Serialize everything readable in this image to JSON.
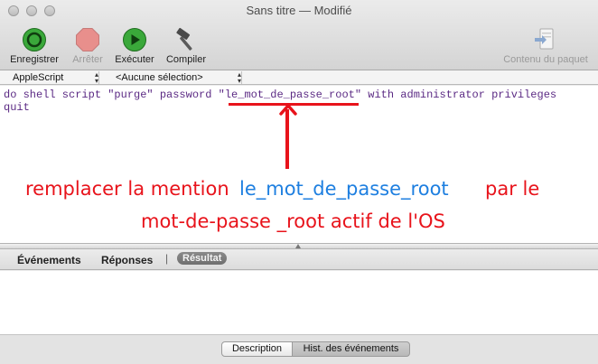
{
  "window": {
    "title": "Sans titre — Modifié"
  },
  "toolbar": {
    "record_label": "Enregistrer",
    "stop_label": "Arrêter",
    "run_label": "Exécuter",
    "compile_label": "Compiler",
    "bundle_label": "Contenu du paquet"
  },
  "selectors": {
    "language": "AppleScript",
    "navigation": "<Aucune sélection>"
  },
  "editor": {
    "line1_prefix": "do shell script \"purge\" password ",
    "line1_string": "\"le_mot_de_passe_root\"",
    "line1_suffix": " with administrator privileges",
    "line2": "quit"
  },
  "annotation": {
    "part1": "remplacer la mention",
    "part2": "le_mot_de_passe_root",
    "part3": "par le",
    "line2": "mot-de-passe _root actif de l'OS"
  },
  "tabs": {
    "events": "Événements",
    "replies": "Réponses",
    "separator": "|",
    "result": "Résultat"
  },
  "bottom": {
    "description": "Description",
    "history": "Hist. des événements"
  },
  "colors": {
    "annotation_red": "#e8131b",
    "annotation_blue": "#1e7fe0",
    "code_purple": "#5b2a84"
  }
}
